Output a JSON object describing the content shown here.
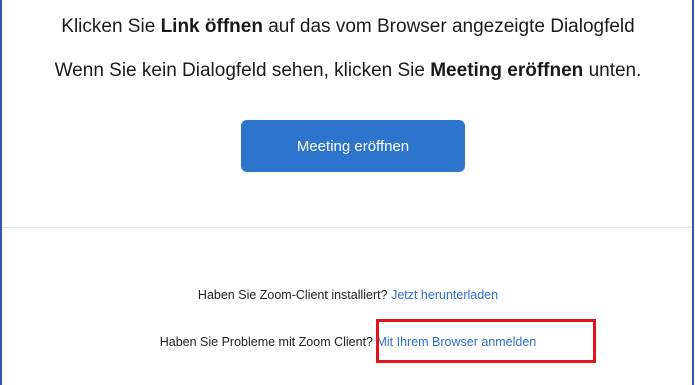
{
  "instructions": {
    "line1_pre": "Klicken Sie ",
    "line1_bold": "Link öffnen",
    "line1_post": " auf das vom Browser angezeigte Dialogfeld",
    "line2_pre": "Wenn Sie kein Dialogfeld sehen, klicken Sie ",
    "line2_bold": "Meeting eröffnen",
    "line2_post": " unten."
  },
  "join_button": {
    "label": "Meeting eröffnen"
  },
  "footer": {
    "installed_question": "Haben Sie Zoom-Client installiert? ",
    "download_link": "Jetzt herunterladen",
    "problems_question": "Haben Sie Probleme mit Zoom Client? ",
    "browser_link": "Mit Ihrem Browser anmelden"
  },
  "colors": {
    "accent": "#2d75cc",
    "link": "#2d6fcb",
    "highlight": "#e1141b",
    "frame_border": "#2b5aa8"
  }
}
